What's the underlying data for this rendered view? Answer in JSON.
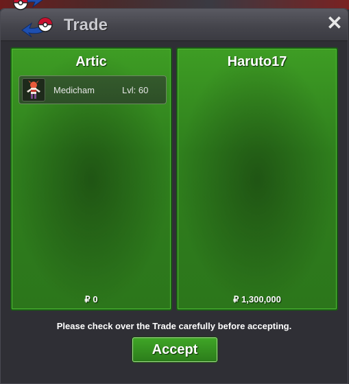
{
  "window": {
    "title": "Trade",
    "close_glyph": "✕"
  },
  "left_panel": {
    "player_name": "Artic",
    "pokemon": [
      {
        "name": "Medicham",
        "level": "Lvl: 60",
        "icon": "medicham-sprite-icon"
      }
    ],
    "currency_symbol": "₽",
    "money": "0"
  },
  "right_panel": {
    "player_name": "Haruto17",
    "pokemon": [],
    "currency_symbol": "₽",
    "money": "1,300,000"
  },
  "footer": {
    "note": "Please check over the Trade carefully before accepting.",
    "accept_label": "Accept"
  },
  "colors": {
    "panel_green": "#2f7f1d",
    "window_bg": "#2f2f35",
    "accent_red": "#c8102e",
    "accent_blue": "#1e4fb0"
  }
}
